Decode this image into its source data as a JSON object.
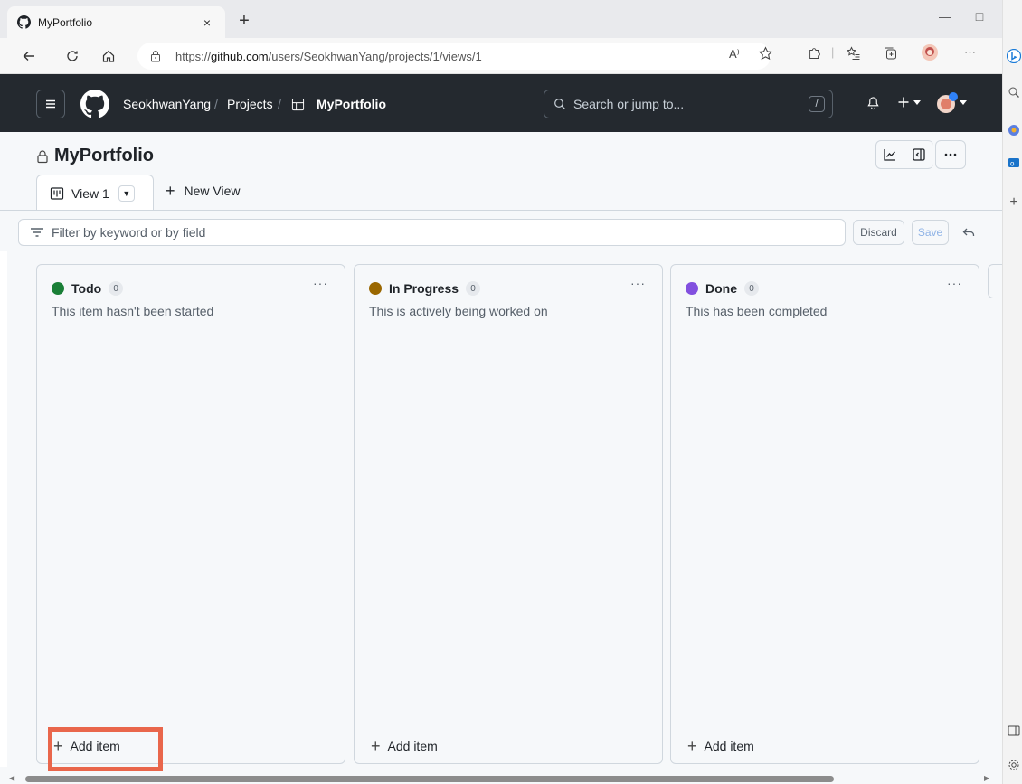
{
  "browser": {
    "tab_title": "MyPortfolio",
    "tab_close": "×",
    "new_tab": "+",
    "url_prefix": "https://",
    "url_host": "github.com",
    "url_path": "/users/SeokhwanYang/projects/1/views/1",
    "read_aloud": "A⁾",
    "more": "⋯"
  },
  "gh": {
    "owner": "SeokhwanYang",
    "projects": "Projects",
    "separator": "/",
    "project": "MyPortfolio",
    "search_placeholder": "Search or jump to...",
    "search_key": "/"
  },
  "project": {
    "title": "MyPortfolio",
    "view_tab": "View 1",
    "new_view": "New View",
    "filter_placeholder": "Filter by keyword or by field",
    "discard": "Discard",
    "save": "Save"
  },
  "columns": [
    {
      "name": "Todo",
      "count": "0",
      "description": "This item hasn't been started",
      "color": "#1a7f37",
      "add": "Add item"
    },
    {
      "name": "In Progress",
      "count": "0",
      "description": "This is actively being worked on",
      "color": "#9a6700",
      "add": "Add item"
    },
    {
      "name": "Done",
      "count": "0",
      "description": "This has been completed",
      "color": "#8250df",
      "add": "Add item"
    }
  ],
  "colors": {
    "header_bg": "#24292f",
    "highlight": "#e9664b"
  }
}
